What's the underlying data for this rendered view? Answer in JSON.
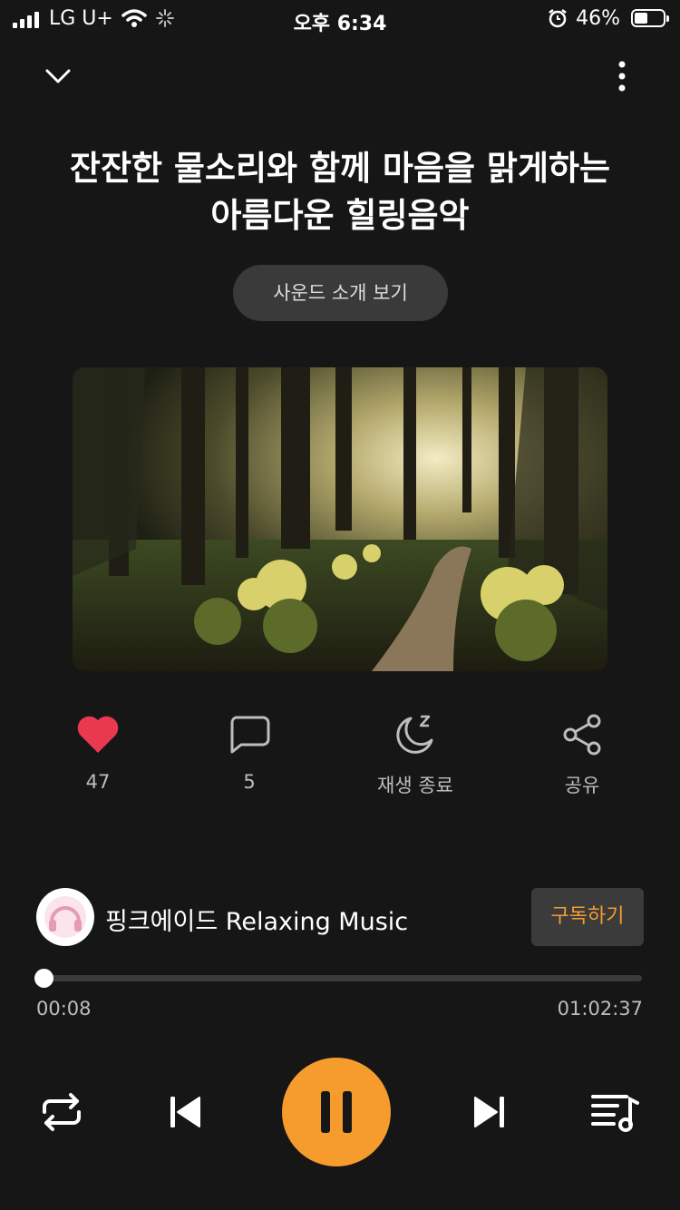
{
  "status_bar": {
    "carrier": "LG U+",
    "time": "오후 6:34",
    "battery_percent": "46%",
    "battery_level": 0.46
  },
  "header": {
    "collapse_icon": "chevron-down-icon",
    "more_icon": "more-vertical-icon"
  },
  "track": {
    "title": "잔잔한 물소리와 함께 마음을 맑게하는\n아름다운 힐링음악"
  },
  "sound_info_button": "사운드 소개 보기",
  "actions": {
    "like": {
      "icon": "heart-icon",
      "label": "47",
      "color": "#e8394f"
    },
    "comment": {
      "icon": "comment-icon",
      "label": "5"
    },
    "sleep_timer": {
      "icon": "moon-zz-icon",
      "label": "재생 종료"
    },
    "share": {
      "icon": "share-icon",
      "label": "공유"
    }
  },
  "channel": {
    "name": "핑크에이드 Relaxing Music",
    "subscribe_label": "구독하기"
  },
  "progress": {
    "current": "00:08",
    "total": "01:02:37",
    "fraction": 0.002
  },
  "controls": {
    "repeat_icon": "repeat-icon",
    "prev_icon": "skip-previous-icon",
    "play_pause_icon": "pause-icon",
    "next_icon": "skip-next-icon",
    "playlist_icon": "playlist-icon",
    "accent_color": "#f69c2d"
  }
}
